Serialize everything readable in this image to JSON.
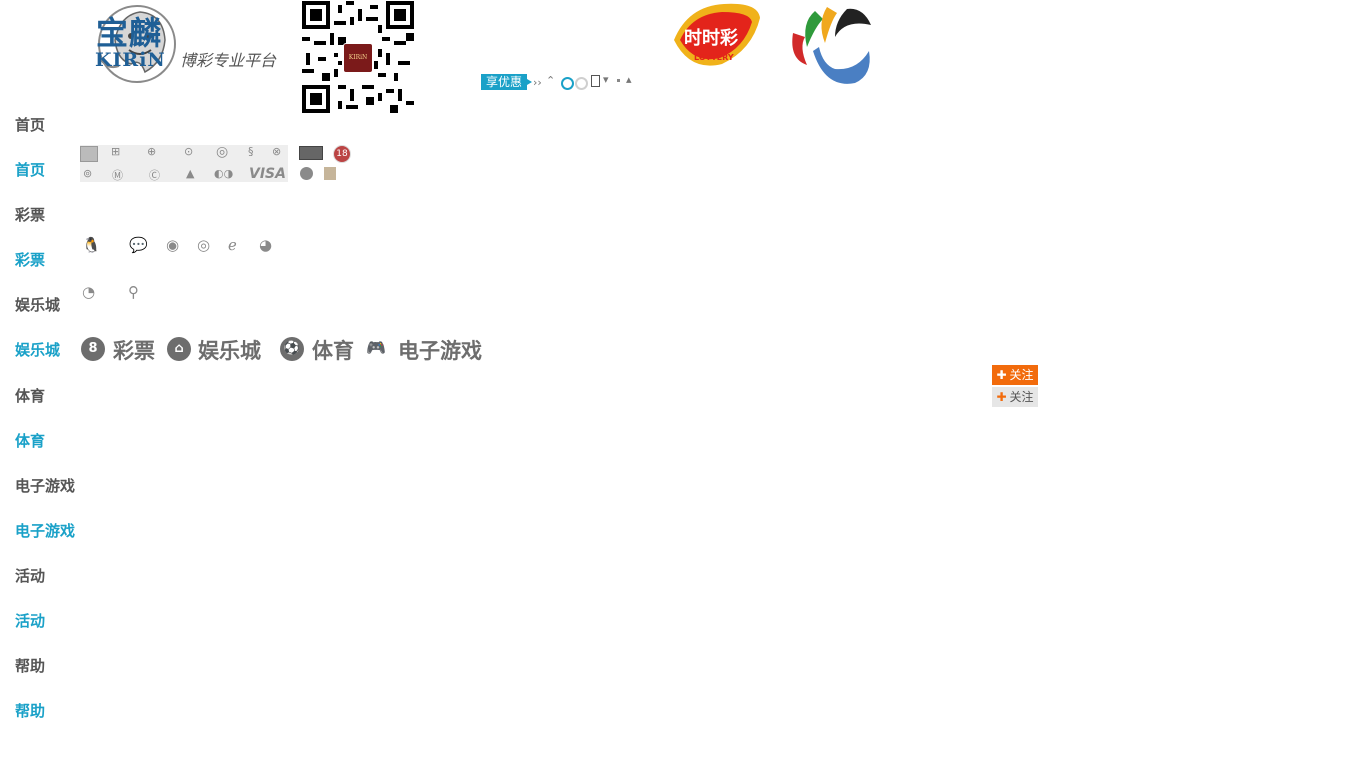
{
  "logo": {
    "brand_cn": "宝麟",
    "brand_en": "KIRiN",
    "tagline": "博彩专业平台"
  },
  "qr": {
    "center_label": "KIRiN"
  },
  "promo": {
    "label": "享优惠"
  },
  "nav": [
    {
      "label": "首页",
      "active": false
    },
    {
      "label": "首页",
      "active": true
    },
    {
      "label": "彩票",
      "active": false
    },
    {
      "label": "彩票",
      "active": true
    },
    {
      "label": "娱乐城",
      "active": false
    },
    {
      "label": "娱乐城",
      "active": true
    },
    {
      "label": "体育",
      "active": false
    },
    {
      "label": "体育",
      "active": true
    },
    {
      "label": "电子游戏",
      "active": false
    },
    {
      "label": "电子游戏",
      "active": true
    },
    {
      "label": "活动",
      "active": false
    },
    {
      "label": "活动",
      "active": true
    },
    {
      "label": "帮助",
      "active": false
    },
    {
      "label": "帮助",
      "active": true
    }
  ],
  "payment": {
    "visa_label": "VISA",
    "age_label": "18"
  },
  "categories": [
    {
      "label": "彩票",
      "icon_glyph": "8"
    },
    {
      "label": "娱乐城",
      "icon_glyph": "⌂"
    },
    {
      "label": "体育",
      "icon_glyph": "⚽"
    },
    {
      "label": "电子游戏",
      "icon_glyph": "🎮"
    }
  ],
  "follow": [
    {
      "label": "关注",
      "color": "#f26b0c"
    },
    {
      "label": "关注",
      "color": "#e6e6e6"
    }
  ],
  "colors": {
    "brand_blue": "#1f5f96",
    "accent": "#1aa1c8",
    "orange": "#f26b0c",
    "nav_text": "#555555"
  }
}
